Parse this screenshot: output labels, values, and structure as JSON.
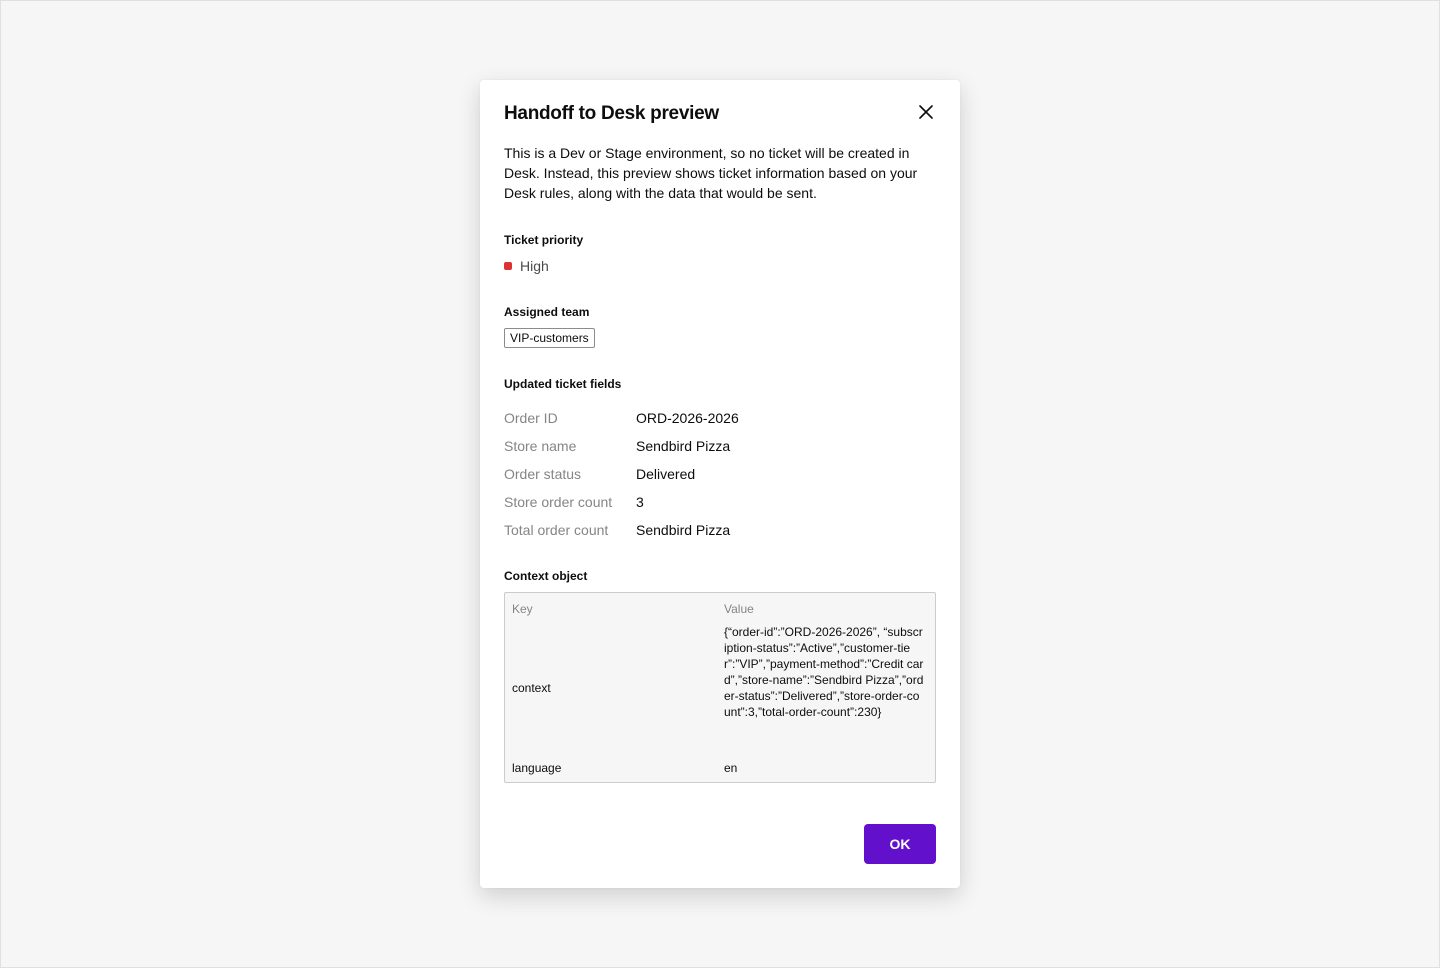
{
  "dialog": {
    "title": "Handoff to Desk preview",
    "description": "This is a Dev or Stage environment, so no ticket will be created in Desk. Instead, this preview shows ticket information based on your Desk rules, along with the data that would be sent.",
    "close_icon": "close-icon",
    "ok_label": "OK"
  },
  "ticket_priority": {
    "label": "Ticket priority",
    "value": "High",
    "color": "#de3232"
  },
  "assigned_team": {
    "label": "Assigned team",
    "value": "VIP-customers"
  },
  "updated_fields": {
    "label": "Updated ticket fields",
    "rows": [
      {
        "key": "Order ID",
        "value": "ORD-2026-2026"
      },
      {
        "key": "Store name",
        "value": "Sendbird Pizza"
      },
      {
        "key": "Order status",
        "value": "Delivered"
      },
      {
        "key": "Store order count",
        "value": "3"
      },
      {
        "key": "Total order count",
        "value": "Sendbird Pizza"
      }
    ]
  },
  "context_object": {
    "label": "Context object",
    "headers": {
      "key": "Key",
      "value": "Value"
    },
    "rows": [
      {
        "key": "context",
        "value": "{“order-id”:”ORD-2026-2026”, “subscription-status”:”Active”,”customer-tier”:”VIP”,”payment-method”:”Credit card”,”store-name”:”Sendbird Pizza”,”order-status”:”Delivered”,”store-order-count”:3,”total-order-count”:230}"
      },
      {
        "key": "language",
        "value": "en"
      }
    ]
  },
  "colors": {
    "accent": "#6210cc",
    "background": "#f6f6f6"
  }
}
